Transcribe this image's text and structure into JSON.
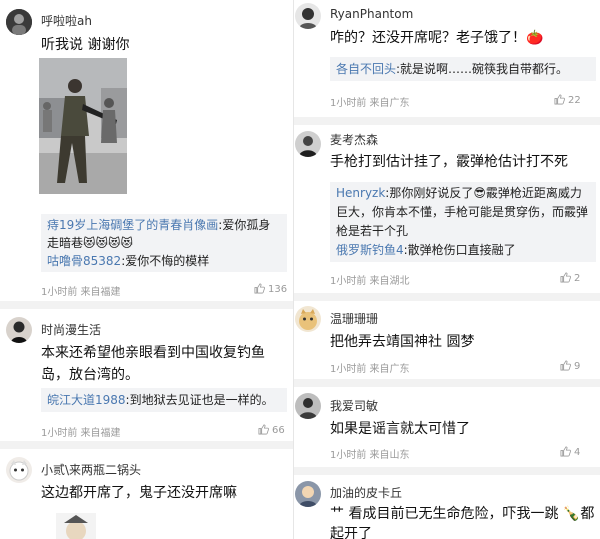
{
  "colors": {
    "reply_name": "#4a78b0",
    "meta": "#9a9a9a",
    "reply_bg": "#f2f3f5"
  },
  "left": [
    {
      "username": "呼啦啦ah",
      "content": "听我说 谢谢你",
      "replies": [
        {
          "name": "痔19岁上海碉堡了的青春肖像画",
          "text": ":爱你孤身走暗巷😻😻😻😻"
        },
        {
          "name": "咕噜骨85382",
          "text": ":爱你不悔的模样"
        }
      ],
      "meta": "1小时前 来自福建",
      "likes": "136"
    },
    {
      "username": "时尚漫生活",
      "content": "本来还希望他亲眼看到中国收复钓鱼岛，放台湾的。",
      "replies": [
        {
          "name": "皖江大道1988",
          "text": ":到地狱去见证也是一样的。"
        }
      ],
      "meta": "1小时前 来自福建",
      "likes": "66"
    },
    {
      "username": "小贰\\来两瓶二锅头",
      "content": "这边都开席了，鬼子还没开席嘛"
    }
  ],
  "right": [
    {
      "username": "RyanPhantom",
      "content": "咋的？还没开席呢？老子饿了！🍅",
      "replies": [
        {
          "name": "各自不回头",
          "text": ":就是说啊……碗筷我自带都行。"
        }
      ],
      "meta": "1小时前 来自广东",
      "likes": "22"
    },
    {
      "username": "麦考杰森",
      "content": "手枪打到估计挂了，霰弹枪估计打不死",
      "replies": [
        {
          "name": "Henryzk",
          "text": ":那你刚好说反了😎霰弹枪近距离威力巨大，你肯本不懂，手枪可能是贯穿伤，而霰弹枪是若干个孔"
        },
        {
          "name": "俄罗斯钓鱼4",
          "text": ":散弹枪伤口直接融了"
        }
      ],
      "meta": "1小时前 来自湖北",
      "likes": "2"
    },
    {
      "username": "温珊珊珊",
      "content": "把他弄去靖国神社 圆梦",
      "meta": "1小时前 来自广东",
      "likes": "9"
    },
    {
      "username": "我爱司敏",
      "content": "如果是谣言就太可惜了",
      "meta": "1小时前 来自山东",
      "likes": "4"
    },
    {
      "username": "加油的皮卡丘",
      "content": "艹 看成目前已无生命危险，吓我一跳 🍾都起开了"
    }
  ]
}
